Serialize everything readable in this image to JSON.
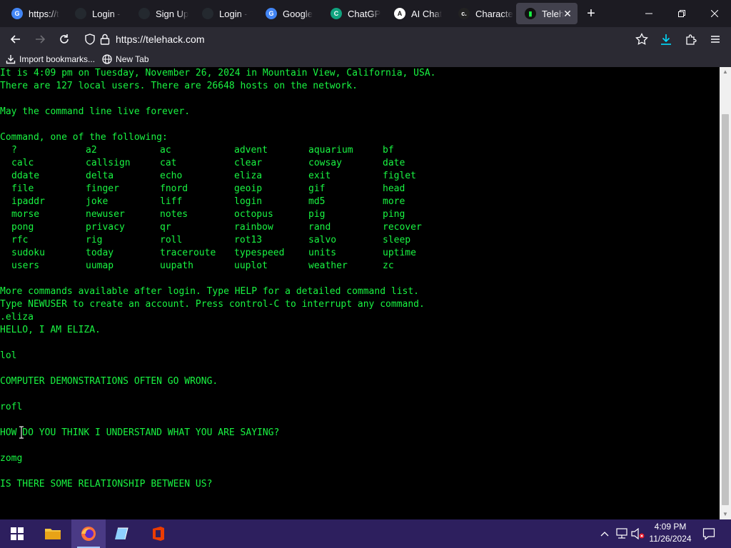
{
  "browser": {
    "tabs": [
      {
        "label": "https://t",
        "icon": "google-icon",
        "color": "#4285f4"
      },
      {
        "label": "Login - ",
        "icon": "github-icon",
        "color": "#24292f"
      },
      {
        "label": "Sign Up",
        "icon": "github-icon",
        "color": "#24292f"
      },
      {
        "label": "Login - ",
        "icon": "github-icon",
        "color": "#24292f"
      },
      {
        "label": "Google",
        "icon": "google-icon",
        "color": "#4285f4"
      },
      {
        "label": "ChatGP",
        "icon": "chatgpt-icon",
        "color": "#10a37f"
      },
      {
        "label": "AI Chat",
        "icon": "ai-chat-icon",
        "color": "#ffffff"
      },
      {
        "label": "Characte",
        "icon": "character-ai-icon",
        "color": "#222222"
      },
      {
        "label": "Teleh",
        "icon": "telehack-icon",
        "color": "#19f542"
      }
    ],
    "active_tab_index": 8,
    "url": "https://telehack.com",
    "bookmarks": [
      {
        "label": "Import bookmarks...",
        "icon": "import-icon"
      },
      {
        "label": "New Tab",
        "icon": "globe-icon"
      }
    ]
  },
  "terminal": {
    "text_color": "#19f542",
    "header_lines": [
      "It is 4:09 pm on Tuesday, November 26, 2024 in Mountain View, California, USA.",
      "There are 127 local users. There are 26648 hosts on the network.",
      "",
      "May the command line live forever.",
      "",
      "Command, one of the following:"
    ],
    "commands": [
      [
        "?",
        "a2",
        "ac",
        "advent",
        "aquarium",
        "bf"
      ],
      [
        "calc",
        "callsign",
        "cat",
        "clear",
        "cowsay",
        "date"
      ],
      [
        "ddate",
        "delta",
        "echo",
        "eliza",
        "exit",
        "figlet"
      ],
      [
        "file",
        "finger",
        "fnord",
        "geoip",
        "gif",
        "head"
      ],
      [
        "ipaddr",
        "joke",
        "liff",
        "login",
        "md5",
        "more"
      ],
      [
        "morse",
        "newuser",
        "notes",
        "octopus",
        "pig",
        "ping"
      ],
      [
        "pong",
        "privacy",
        "qr",
        "rainbow",
        "rand",
        "recover"
      ],
      [
        "rfc",
        "rig",
        "roll",
        "rot13",
        "salvo",
        "sleep"
      ],
      [
        "sudoku",
        "today",
        "traceroute",
        "typespeed",
        "units",
        "uptime"
      ],
      [
        "users",
        "uumap",
        "uupath",
        "uuplot",
        "weather",
        "zc"
      ]
    ],
    "footer_lines": [
      "",
      "More commands available after login. Type HELP for a detailed command list.",
      "Type NEWUSER to create an account. Press control-C to interrupt any command.",
      ".eliza",
      "HELLO, I AM ELIZA.",
      "",
      "lol",
      "",
      "COMPUTER DEMONSTRATIONS OFTEN GO WRONG.",
      "",
      "rofl",
      "",
      "HOW DO YOU THINK I UNDERSTAND WHAT YOU ARE SAYING?",
      "",
      "zomg",
      "",
      "IS THERE SOME RELATIONSHIP BETWEEN US?"
    ]
  },
  "taskbar": {
    "apps": [
      {
        "name": "start-icon"
      },
      {
        "name": "file-explorer-icon"
      },
      {
        "name": "firefox-icon",
        "active": true
      },
      {
        "name": "notepad-icon"
      },
      {
        "name": "office-icon"
      }
    ],
    "clock_time": "4:09 PM",
    "clock_date": "11/26/2024"
  }
}
